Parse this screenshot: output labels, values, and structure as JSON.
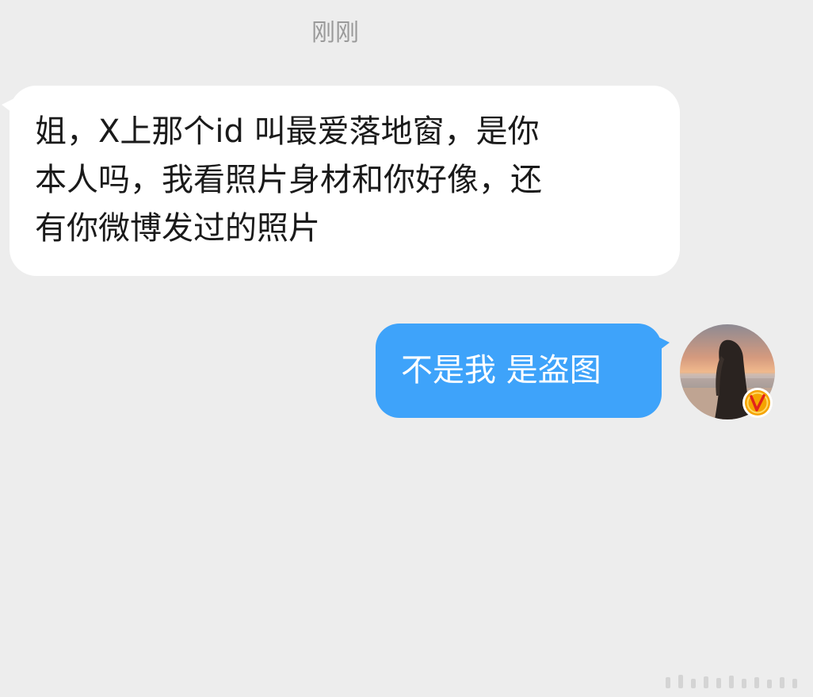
{
  "chat": {
    "timestamp": "刚刚",
    "messages": [
      {
        "side": "incoming",
        "lines": [
          "姐，X上那个id 叫最爱落地窗，是你",
          "本人吗，我看照片身材和你好像，还",
          "有你微博发过的照片"
        ]
      },
      {
        "side": "outgoing",
        "text": "不是我 是盗图"
      }
    ]
  },
  "colors": {
    "background": "#ededed",
    "incoming_bubble": "#ffffff",
    "outgoing_bubble": "#3ea3fa",
    "timestamp_text": "#9a9a9a",
    "verified_badge": "#f5a300"
  },
  "icons": {
    "avatar": "avatar-photo",
    "badge": "verified-v-icon"
  }
}
